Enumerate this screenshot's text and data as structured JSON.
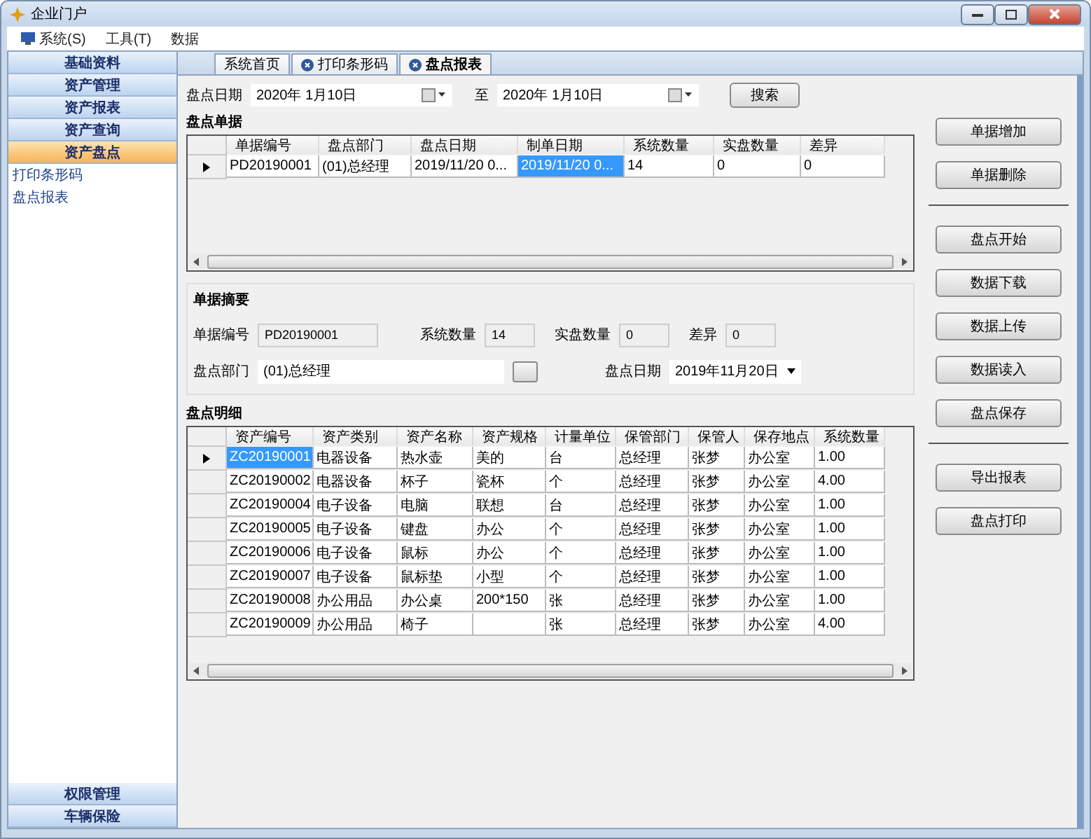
{
  "window": {
    "title": "企业门户"
  },
  "menu": [
    {
      "label": "系统(S)",
      "kind": "icon"
    },
    {
      "label": "工具(T)",
      "kind": "plain"
    },
    {
      "label": "数据",
      "kind": "plain"
    }
  ],
  "sidebar": {
    "sections": [
      {
        "label": "基础资料",
        "selected": false
      },
      {
        "label": "资产管理",
        "selected": false
      },
      {
        "label": "资产报表",
        "selected": false
      },
      {
        "label": "资产查询",
        "selected": false
      },
      {
        "label": "资产盘点",
        "selected": true
      }
    ],
    "items": [
      "打印条形码",
      "盘点报表"
    ],
    "bottom_sections": [
      {
        "label": "权限管理",
        "selected": false
      },
      {
        "label": "车辆保险",
        "selected": false
      }
    ]
  },
  "tabs": [
    {
      "label": "系统首页",
      "closable": false,
      "selected": false
    },
    {
      "label": "打印条形码",
      "closable": true,
      "selected": false
    },
    {
      "label": "盘点报表",
      "closable": true,
      "selected": true
    }
  ],
  "filter": {
    "label": "盘点日期",
    "from": "2020年 1月10日",
    "to_label": "至",
    "to": "2020年 1月10日",
    "search": "搜索"
  },
  "vouchers": {
    "title": "盘点单据",
    "columns": [
      "单据编号",
      "盘点部门",
      "盘点日期",
      "制单日期",
      "系统数量",
      "实盘数量",
      "差异"
    ],
    "rows": [
      {
        "current": true,
        "cells": [
          {
            "text": "PD20190001",
            "selected": false
          },
          {
            "text": "(01)总经理",
            "selected": false
          },
          {
            "text": "2019/11/20 0...",
            "selected": false
          },
          {
            "text": "2019/11/20 0...",
            "selected": true
          },
          {
            "text": "14",
            "selected": false
          },
          {
            "text": "0",
            "selected": false
          },
          {
            "text": "0",
            "selected": false
          }
        ]
      }
    ]
  },
  "summary": {
    "title": "单据摘要",
    "no_label": "单据编号",
    "no": "PD20190001",
    "sys_label": "系统数量",
    "sys": "14",
    "real_label": "实盘数量",
    "real": "0",
    "diff_label": "差异",
    "diff": "0",
    "dept_label": "盘点部门",
    "dept": "(01)总经理",
    "date_label": "盘点日期",
    "date": "2019年11月20日"
  },
  "details": {
    "title": "盘点明细",
    "columns": [
      "资产编号",
      "资产类别",
      "资产名称",
      "资产规格",
      "计量单位",
      "保管部门",
      "保管人",
      "保存地点",
      "系统数量"
    ],
    "rows": [
      {
        "current": true,
        "cells": [
          {
            "text": "ZC20190001",
            "selected": true
          },
          {
            "text": "电器设备",
            "selected": false
          },
          {
            "text": "热水壶",
            "selected": false
          },
          {
            "text": "美的",
            "selected": false
          },
          {
            "text": "台",
            "selected": false
          },
          {
            "text": "总经理",
            "selected": false
          },
          {
            "text": "张梦",
            "selected": false
          },
          {
            "text": "办公室",
            "selected": false
          },
          {
            "text": "1.00",
            "selected": false
          }
        ]
      },
      {
        "current": false,
        "cells": [
          {
            "text": "ZC20190002",
            "selected": false
          },
          {
            "text": "电器设备",
            "selected": false
          },
          {
            "text": "杯子",
            "selected": false
          },
          {
            "text": "瓷杯",
            "selected": false
          },
          {
            "text": "个",
            "selected": false
          },
          {
            "text": "总经理",
            "selected": false
          },
          {
            "text": "张梦",
            "selected": false
          },
          {
            "text": "办公室",
            "selected": false
          },
          {
            "text": "4.00",
            "selected": false
          }
        ]
      },
      {
        "current": false,
        "cells": [
          {
            "text": "ZC20190004",
            "selected": false
          },
          {
            "text": "电子设备",
            "selected": false
          },
          {
            "text": "电脑",
            "selected": false
          },
          {
            "text": "联想",
            "selected": false
          },
          {
            "text": "台",
            "selected": false
          },
          {
            "text": "总经理",
            "selected": false
          },
          {
            "text": "张梦",
            "selected": false
          },
          {
            "text": "办公室",
            "selected": false
          },
          {
            "text": "1.00",
            "selected": false
          }
        ]
      },
      {
        "current": false,
        "cells": [
          {
            "text": "ZC20190005",
            "selected": false
          },
          {
            "text": "电子设备",
            "selected": false
          },
          {
            "text": "键盘",
            "selected": false
          },
          {
            "text": "办公",
            "selected": false
          },
          {
            "text": "个",
            "selected": false
          },
          {
            "text": "总经理",
            "selected": false
          },
          {
            "text": "张梦",
            "selected": false
          },
          {
            "text": "办公室",
            "selected": false
          },
          {
            "text": "1.00",
            "selected": false
          }
        ]
      },
      {
        "current": false,
        "cells": [
          {
            "text": "ZC20190006",
            "selected": false
          },
          {
            "text": "电子设备",
            "selected": false
          },
          {
            "text": "鼠标",
            "selected": false
          },
          {
            "text": "办公",
            "selected": false
          },
          {
            "text": "个",
            "selected": false
          },
          {
            "text": "总经理",
            "selected": false
          },
          {
            "text": "张梦",
            "selected": false
          },
          {
            "text": "办公室",
            "selected": false
          },
          {
            "text": "1.00",
            "selected": false
          }
        ]
      },
      {
        "current": false,
        "cells": [
          {
            "text": "ZC20190007",
            "selected": false
          },
          {
            "text": "电子设备",
            "selected": false
          },
          {
            "text": "鼠标垫",
            "selected": false
          },
          {
            "text": "小型",
            "selected": false
          },
          {
            "text": "个",
            "selected": false
          },
          {
            "text": "总经理",
            "selected": false
          },
          {
            "text": "张梦",
            "selected": false
          },
          {
            "text": "办公室",
            "selected": false
          },
          {
            "text": "1.00",
            "selected": false
          }
        ]
      },
      {
        "current": false,
        "cells": [
          {
            "text": "ZC20190008",
            "selected": false
          },
          {
            "text": "办公用品",
            "selected": false
          },
          {
            "text": "办公桌",
            "selected": false
          },
          {
            "text": "200*150",
            "selected": false
          },
          {
            "text": "张",
            "selected": false
          },
          {
            "text": "总经理",
            "selected": false
          },
          {
            "text": "张梦",
            "selected": false
          },
          {
            "text": "办公室",
            "selected": false
          },
          {
            "text": "1.00",
            "selected": false
          }
        ]
      },
      {
        "current": false,
        "cells": [
          {
            "text": "ZC20190009",
            "selected": false
          },
          {
            "text": "办公用品",
            "selected": false
          },
          {
            "text": "椅子",
            "selected": false
          },
          {
            "text": "",
            "selected": false
          },
          {
            "text": "张",
            "selected": false
          },
          {
            "text": "总经理",
            "selected": false
          },
          {
            "text": "张梦",
            "selected": false
          },
          {
            "text": "办公室",
            "selected": false
          },
          {
            "text": "4.00",
            "selected": false
          }
        ]
      }
    ]
  },
  "button_groups": [
    [
      "单据增加",
      "单据删除"
    ],
    [
      "盘点开始",
      "数据下载",
      "数据上传",
      "数据读入",
      "盘点保存"
    ],
    [
      "导出报表",
      "盘点打印"
    ]
  ]
}
